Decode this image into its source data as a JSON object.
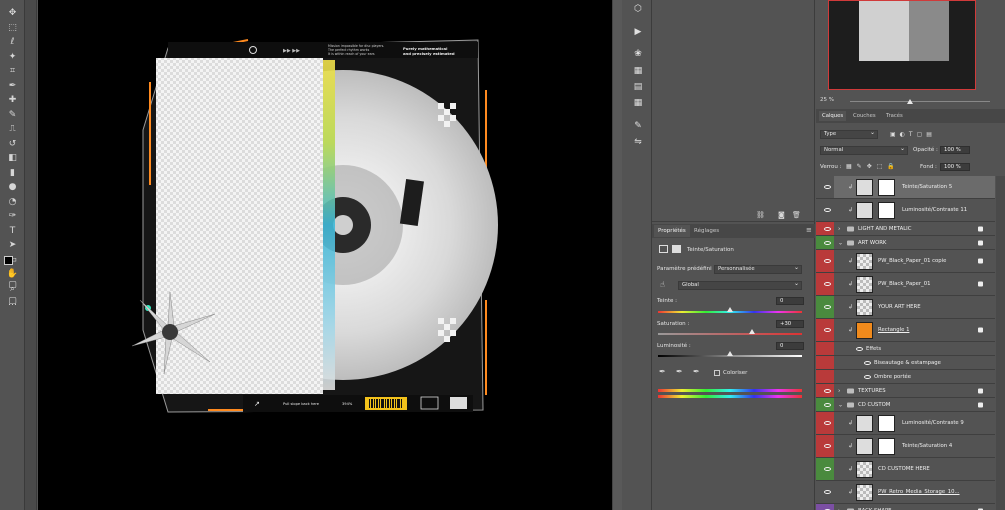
{
  "toolbar": {
    "tools": [
      "move-icon",
      "marquee-icon",
      "lasso-icon",
      "magic-wand-icon",
      "crop-icon",
      "eyedropper-icon",
      "healing-icon",
      "brush-icon",
      "stamp-icon",
      "history-brush-icon",
      "eraser-icon",
      "gradient-icon",
      "blur-icon",
      "dodge-icon",
      "pen-icon",
      "type-icon",
      "path-select-icon",
      "rectangle-icon",
      "hand-icon",
      "zoom-icon",
      "more-icon"
    ]
  },
  "artwork": {
    "header_text_1": "Mission impossible for disc players.",
    "header_text_2": "The perfect rhythm works",
    "header_text_3": "It is within reach of your ears",
    "header_right_1": "Purely mathematical",
    "header_right_2": "and precisely estimated",
    "footer_text": "Pull slope back here",
    "footer_pct": "394%"
  },
  "navigator": {
    "zoom": "25 %"
  },
  "layers_panel": {
    "tabs": [
      "Calques",
      "Couches",
      "Tracés"
    ],
    "active_tab": "Calques",
    "filter_type": "Type",
    "blend_mode": "Normal",
    "opacity_label": "Opacité :",
    "opacity_value": "100 %",
    "lock_label": "Verrou :",
    "fill_label": "Fond :",
    "fill_value": "100 %",
    "layers": [
      {
        "name": "Teinte/Saturation 5",
        "kind": "adjust",
        "color": "#535353",
        "selected": true
      },
      {
        "name": "Luminosité/Contraste 11",
        "kind": "adjust",
        "color": "#535353"
      },
      {
        "name": "LIGHT AND METALIC",
        "kind": "group",
        "color": "#b93a3a"
      },
      {
        "name": "ART WORK",
        "kind": "group-open",
        "color": "#4a8a3e"
      },
      {
        "name": "PW_Black_Paper_01 copie",
        "kind": "image",
        "color": "#b93a3a"
      },
      {
        "name": "PW_Black_Paper_01",
        "kind": "image",
        "color": "#b93a3a"
      },
      {
        "name": "YOUR ART HERE",
        "kind": "smart",
        "color": "#4a8a3e"
      },
      {
        "name": "Rectangle 1",
        "kind": "shape",
        "color": "#b93a3a"
      },
      {
        "name": "Effets",
        "kind": "effects",
        "color": "#b93a3a"
      },
      {
        "name": "Biseautage & estampage",
        "kind": "effect",
        "color": "#b93a3a"
      },
      {
        "name": "Ombre portée",
        "kind": "effect",
        "color": "#b93a3a"
      },
      {
        "name": "TEXTURES",
        "kind": "group",
        "color": "#b93a3a"
      },
      {
        "name": "CD CUSTOM",
        "kind": "group-open",
        "color": "#4a8a3e"
      },
      {
        "name": "Luminosité/Contraste 9",
        "kind": "adjust",
        "color": "#b93a3a"
      },
      {
        "name": "Teinte/Saturation 4",
        "kind": "adjust",
        "color": "#b93a3a"
      },
      {
        "name": "CD CUSTOME HERE",
        "kind": "smart",
        "color": "#4a8a3e"
      },
      {
        "name": "PW_Retro_Media_Storage_10...",
        "kind": "image",
        "color": "#535353"
      },
      {
        "name": "BACK SHAPE",
        "kind": "group",
        "color": "#7b4fa3"
      }
    ]
  },
  "properties_panel": {
    "tabs": [
      "Propriétés",
      "Réglages"
    ],
    "active_tab": "Propriétés",
    "title": "Teinte/Saturation",
    "preset_label": "Paramètre prédéfini :",
    "preset_value": "Personnalisée",
    "channel": "Global",
    "hue_label": "Teinte :",
    "hue_value": "0",
    "hue_level": 0.5,
    "saturation_label": "Saturation :",
    "saturation_value": "+30",
    "saturation_level": 0.65,
    "lightness_label": "Luminosité :",
    "lightness_value": "0",
    "lightness_level": 0.5,
    "colorize_label": "Coloriser"
  }
}
